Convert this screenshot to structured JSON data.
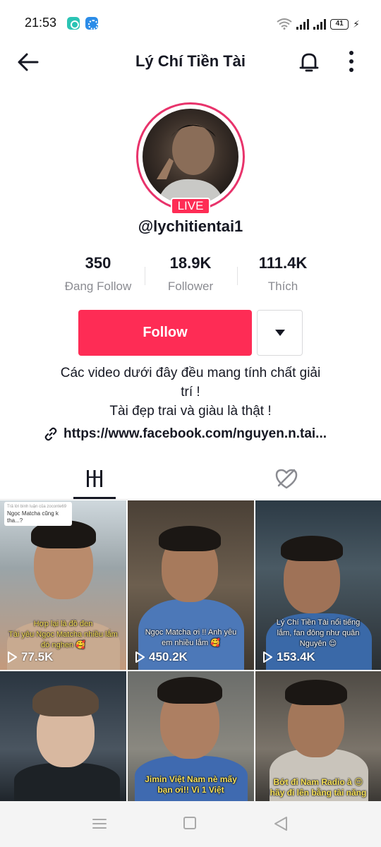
{
  "status_bar": {
    "time": "21:53",
    "battery": "41"
  },
  "header": {
    "title": "Lý Chí Tiền Tài"
  },
  "profile": {
    "live_badge": "LIVE",
    "username": "@lychitientai1",
    "stats": [
      {
        "value": "350",
        "label": "Đang Follow"
      },
      {
        "value": "18.9K",
        "label": "Follower"
      },
      {
        "value": "111.4K",
        "label": "Thích"
      }
    ],
    "follow_label": "Follow",
    "bio_line1": "Các video dưới đây đều mang tính chất giải",
    "bio_line2": "trí !",
    "bio_line3": "Tài đẹp trai và giàu là thật !",
    "link": "https://www.facebook.com/nguyen.n.tai..."
  },
  "videos": [
    {
      "views": "77.5K",
      "caption": "Hợp lại là đồ đen\nTài yêu Ngọc Matcha nhiều lắm\nđó nghen 🥰",
      "note_small": "Trả lời bình luận của zoconte69",
      "note_text": "Ngọc Matcha cũng k tha...?"
    },
    {
      "views": "450.2K",
      "caption": "Ngọc Matcha ơi !! Anh yêu\nem nhiều lắm 🥰"
    },
    {
      "views": "153.4K",
      "caption": "Lý Chí Tiền Tài nổi tiếng\nlắm, fan đông như quân\nNguyên 😌"
    },
    {
      "views": "",
      "caption": ""
    },
    {
      "views": "",
      "caption": "Jimin Việt Nam nè mấy\nbạn ơi!! Vì 1 Việt"
    },
    {
      "views": "",
      "caption": "Bớt đi Nam Radio à 😌\nhãy đi lên bằng tài năng"
    }
  ],
  "colors": {
    "accent": "#fe2c55",
    "live": "#e8336b",
    "text": "#161823",
    "muted": "#8a8b91"
  }
}
